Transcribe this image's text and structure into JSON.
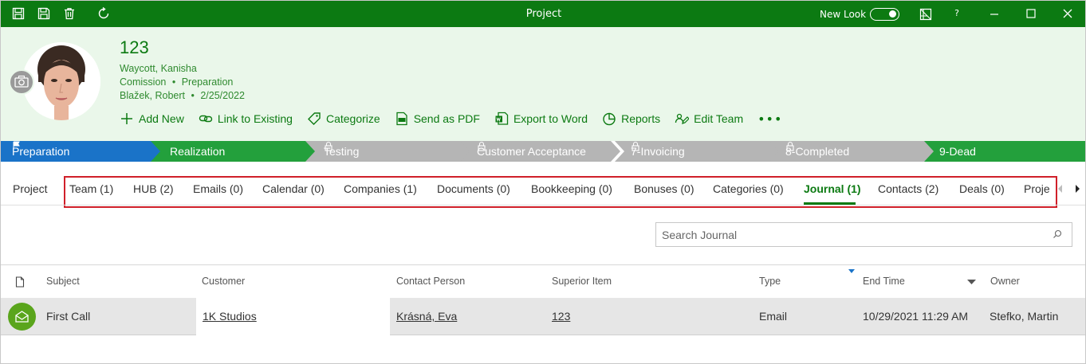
{
  "window": {
    "title": "Project",
    "new_look_label": "New Look",
    "help_label": "?"
  },
  "record": {
    "number": "123",
    "person": "Waycott, Kanisha",
    "type": "Comission",
    "stage": "Preparation",
    "owner": "Blažek, Robert",
    "date": "2/25/2022",
    "separator": "•"
  },
  "actions": [
    {
      "label": "Add New",
      "icon": "plus-icon"
    },
    {
      "label": "Link to Existing",
      "icon": "link-icon"
    },
    {
      "label": "Categorize",
      "icon": "tag-icon"
    },
    {
      "label": "Send as PDF",
      "icon": "pdf-icon"
    },
    {
      "label": "Export to Word",
      "icon": "word-icon"
    },
    {
      "label": "Reports",
      "icon": "pie-chart-icon"
    },
    {
      "label": "Edit Team",
      "icon": "edit-team-icon"
    }
  ],
  "more_label": "•••",
  "stages": [
    {
      "label": "Preparation",
      "color": "#1a73c8",
      "status": "current"
    },
    {
      "label": "Realization",
      "color": "#23a03c",
      "status": "open"
    },
    {
      "label": "Testing",
      "color": "#b5b5b5",
      "status": "locked"
    },
    {
      "label": "Customer Acceptance",
      "color": "#b5b5b5",
      "status": "locked"
    },
    {
      "label": "7-Invoicing",
      "color": "#b5b5b5",
      "status": "locked"
    },
    {
      "label": "8-Completed",
      "color": "#b5b5b5",
      "status": "locked"
    },
    {
      "label": "9-Dead",
      "color": "#23a03c",
      "status": "open"
    }
  ],
  "tabs": [
    {
      "label": "Project"
    },
    {
      "label": "Team (1)"
    },
    {
      "label": "HUB (2)"
    },
    {
      "label": "Emails (0)"
    },
    {
      "label": "Calendar (0)"
    },
    {
      "label": "Companies (1)"
    },
    {
      "label": "Documents (0)"
    },
    {
      "label": "Bookkeeping (0)"
    },
    {
      "label": "Bonuses (0)"
    },
    {
      "label": "Categories (0)"
    },
    {
      "label": "Journal (1)",
      "active": true
    },
    {
      "label": "Contacts (2)"
    },
    {
      "label": "Deals (0)"
    },
    {
      "label": "Proje"
    }
  ],
  "search": {
    "placeholder": "Search Journal",
    "value": ""
  },
  "columns": {
    "subject": "Subject",
    "customer": "Customer",
    "contact_person": "Contact Person",
    "superior_item": "Superior Item",
    "type": "Type",
    "end_time": "End Time",
    "owner": "Owner"
  },
  "rows": [
    {
      "subject": "First Call",
      "customer": "1K Studios",
      "contact_person": "Krásná, Eva",
      "superior_item": "123",
      "type": "Email",
      "end_time": "10/29/2021 11:29 AM",
      "owner": "Stefko, Martin"
    }
  ],
  "colors": {
    "brand_green": "#0c7a12",
    "header_bg": "#eaf7ea",
    "highlight_red": "#d0202a"
  }
}
